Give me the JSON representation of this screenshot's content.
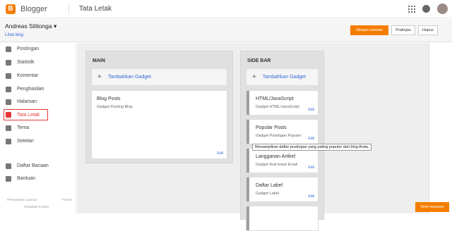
{
  "header": {
    "brand": "Blogger",
    "page_title": "Tata Letak"
  },
  "subbar": {
    "blog_name": "Andreas Silitonga",
    "view_blog": "Lihat blog",
    "save_label": "Simpan setelan",
    "preview_label": "Pratinjau",
    "delete_label": "Hapus"
  },
  "sidebar": {
    "items": [
      {
        "label": "Postingan",
        "icon": "posts-icon"
      },
      {
        "label": "Statistik",
        "icon": "stats-icon"
      },
      {
        "label": "Komentar",
        "icon": "comment-icon"
      },
      {
        "label": "Penghasilan",
        "icon": "dollar-icon"
      },
      {
        "label": "Halaman",
        "icon": "page-icon"
      },
      {
        "label": "Tata Letak",
        "icon": "layout-icon",
        "active": true
      },
      {
        "label": "Tema",
        "icon": "theme-icon"
      },
      {
        "label": "Setelan",
        "icon": "gear-icon"
      },
      {
        "label": "Daftar Bacaan",
        "icon": "bookmark-icon"
      },
      {
        "label": "Bantuan",
        "icon": "help-icon"
      }
    ],
    "footer": {
      "terms": "Persyaratan Layanan",
      "privacy": "Privasi",
      "content_policy": "Kebijakan Konten"
    }
  },
  "layout": {
    "main": {
      "title": "MAIN",
      "add_gadget": "Tambahkan Gadget",
      "gadgets": [
        {
          "title": "Blog Posts",
          "subtitle": "Gadget Posting Blog",
          "edit": "Edit"
        }
      ]
    },
    "side": {
      "title": "SIDE BAR",
      "add_gadget": "Tambahkan Gadget",
      "gadgets": [
        {
          "title": "HTML/JavaScript",
          "subtitle": "Gadget HTML/JavaScript",
          "edit": "Edit"
        },
        {
          "title": "Popular Posts",
          "subtitle": "Gadget Postingan Populer",
          "edit": "Edit"
        },
        {
          "title": "Langganan Artikel",
          "subtitle": "Gadget Ikuti lewat Email",
          "edit": "Edit"
        },
        {
          "title": "Daftar Label",
          "subtitle": "Gadget Label",
          "edit": "Edit"
        }
      ]
    }
  },
  "tooltip": "Menampilkan daftar postingan yang paling populer dari blog Anda.",
  "feedback": "Kirim masukan",
  "colors": {
    "accent": "#f57d00",
    "active": "#e53935",
    "link": "#3367d6"
  }
}
